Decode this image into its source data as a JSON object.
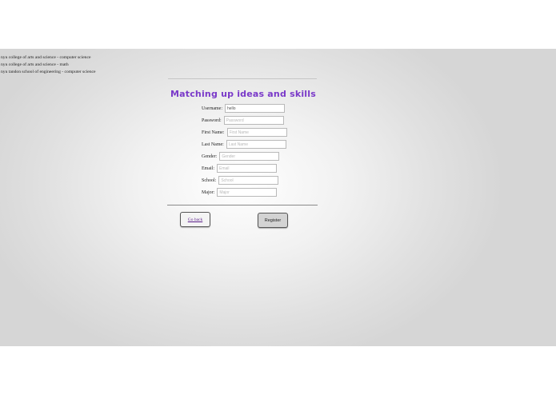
{
  "suggestions": [
    "nyu college of arts and science - computer science",
    "nyu college of arts and science - math",
    "nyu tandon school of engineering - computer science"
  ],
  "title": "Matching up ideas and skills",
  "form": {
    "username": {
      "label": "Username:",
      "value": "hello"
    },
    "password": {
      "label": "Password:",
      "placeholder": "Password"
    },
    "first_name": {
      "label": "First Name:",
      "placeholder": "First Name"
    },
    "last_name": {
      "label": "Last Name:",
      "placeholder": "Last Name"
    },
    "gender": {
      "label": "Gender:",
      "placeholder": "Gender"
    },
    "email": {
      "label": "Email:",
      "placeholder": "Email"
    },
    "school": {
      "label": "School:",
      "placeholder": "School"
    },
    "major": {
      "label": "Major:",
      "placeholder": "Major"
    }
  },
  "buttons": {
    "go_back": "Go back",
    "register": "Register"
  },
  "colors": {
    "title": "#7a39c9",
    "link": "#5a1e8a"
  }
}
